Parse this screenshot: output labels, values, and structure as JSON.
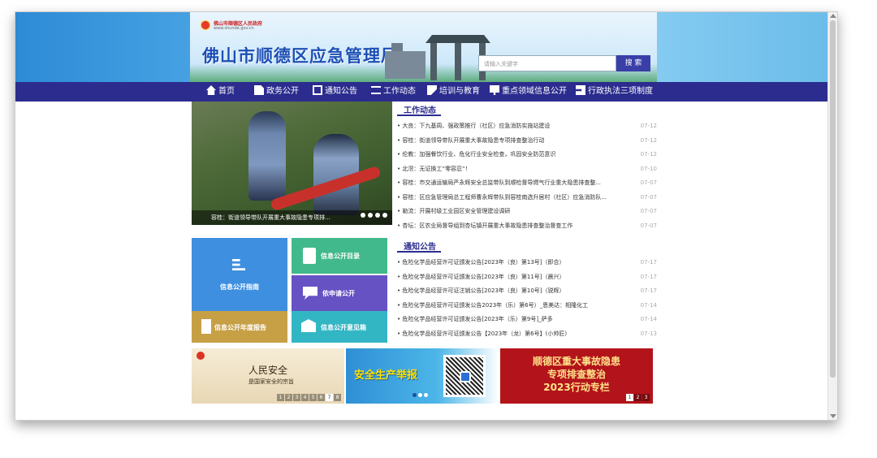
{
  "header": {
    "gov_name": "佛山市顺德区人民政府",
    "gov_url": "www.shunde.gov.cn",
    "site_title": "佛山市顺德区应急管理局",
    "search_placeholder": "请输入关键字",
    "search_button": "搜 索"
  },
  "nav": {
    "items": [
      {
        "label": "首页",
        "icon": "home-icon"
      },
      {
        "label": "政务公开",
        "icon": "document-icon"
      },
      {
        "label": "通知公告",
        "icon": "board-icon"
      },
      {
        "label": "工作动态",
        "icon": "lines-icon"
      },
      {
        "label": "培训与教育",
        "icon": "pen-icon"
      },
      {
        "label": "重点领域信息公开",
        "icon": "screen-icon"
      },
      {
        "label": "行政执法三项制度",
        "icon": "law-icon"
      }
    ]
  },
  "slider": {
    "caption": "容桂：街道领导带队开展重大事故隐患专项排..."
  },
  "work_news": {
    "title": "工作动态",
    "items": [
      {
        "text": "• 大良：下九基周、强政策推行（社区）应急消防实施站建设",
        "date": "07-12"
      },
      {
        "text": "• 容桂：街道领导带队开展重大事故隐患专项排查整治行动",
        "date": "07-12"
      },
      {
        "text": "• 伦教：加强餐饮行业、危化行业安全检查，巩固安全防范意识",
        "date": "07-12"
      },
      {
        "text": "• 北滘：无证换工“零容忍”！",
        "date": "07-10"
      },
      {
        "text": "• 容桂：市交通运输局严永辉安全总监带队到顺检督导燃气行业重大隐患排查整...",
        "date": "07-07"
      },
      {
        "text": "• 容桂：区应急管理局总工程师曹永辉带队到容桂南选升居村（社区）应急消防队...",
        "date": "07-07"
      },
      {
        "text": "• 勒流：开展村级工业园区安全管理建设调研",
        "date": "07-07"
      },
      {
        "text": "• 杏坛：区农业局督导组到杏坛镇开展重大事故隐患排查整治督查工作",
        "date": "07-07"
      }
    ]
  },
  "notices": {
    "title": "通知公告",
    "items": [
      {
        "text": "• 危险化学品经营许可证颁发公告[2023年（良）第13号]（即合）",
        "date": "07-17"
      },
      {
        "text": "• 危险化学品经营许可证颁发公告[2023年（良）第11号]（晨兴）",
        "date": "07-17"
      },
      {
        "text": "• 危险化学品经营许可证注销公告[2023年（良）第10号]（锐辉）",
        "date": "07-17"
      },
      {
        "text": "• 危险化学品经营许可证颁发公告2023年（乐）第6号）_恩美达：相隆化工",
        "date": "07-14"
      },
      {
        "text": "• 危险化学品经营许可证颁发公告[2023年（乐）第9号]_萨多",
        "date": "07-14"
      },
      {
        "text": "• 危险化学品经营许可证颁发公告【2023年（龙）第6号】(小帅匠)",
        "date": "07-13"
      }
    ]
  },
  "tiles": {
    "guide": "信息公开指南",
    "catalog": "信息公开目录",
    "apply": "依申请公开",
    "report": "信息公开年度报告",
    "opinion": "信息公开意见箱"
  },
  "ads": {
    "ad1_title": "人民安全",
    "ad1_sub": "是国家安全的宗旨",
    "ad1_pages": [
      "1",
      "2",
      "3",
      "4",
      "5",
      "6",
      "7",
      "8"
    ],
    "ad2_title": "安全生产举报",
    "ad3_lines": [
      "顺德区重大事故隐患",
      "专项排查整治",
      "2023行动专栏"
    ],
    "ad3_pages": [
      "1",
      "2",
      "3"
    ]
  },
  "colors": {
    "nav_bg": "#2b2c8e",
    "accent": "#2b2c8e",
    "tile_guide": "#3e8fe0",
    "tile_catalog": "#41b98c",
    "tile_apply": "#6752c4",
    "tile_report": "#c7a046",
    "tile_opinion": "#33b6c4",
    "ad3_bg": "#b3131a"
  }
}
